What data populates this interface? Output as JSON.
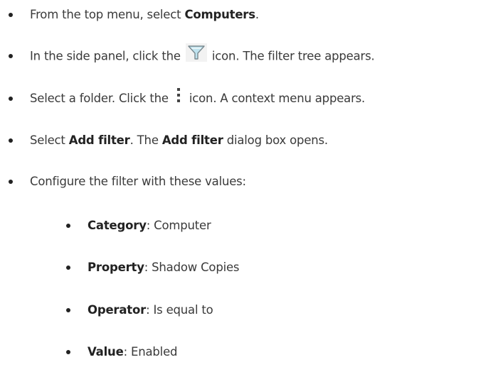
{
  "steps": [
    {
      "pre": "From the top menu, select ",
      "bold": "Computers",
      "post": "."
    },
    {
      "pre": "In the side panel, click the ",
      "icon": "filter-icon",
      "post": " icon. The filter tree appears."
    },
    {
      "pre": "Select a folder. Click the ",
      "icon": "vertical-ellipsis-icon",
      "post": " icon. A context menu appears."
    },
    {
      "pre": "Select ",
      "bold1": "Add filter",
      "mid": ". The ",
      "bold2": "Add filter",
      "post": " dialog box opens."
    },
    {
      "text": "Configure the filter with these values:"
    }
  ],
  "values": [
    {
      "label": "Category",
      "value": ": Computer"
    },
    {
      "label": "Property",
      "value": ": Shadow Copies"
    },
    {
      "label": "Operator",
      "value": ": Is equal to"
    },
    {
      "label": "Value",
      "value": ": Enabled"
    }
  ],
  "colors": {
    "text": "#3a3a3a",
    "bold": "#222222",
    "icon_fill": "#9fd6e8",
    "icon_stroke": "#888888"
  }
}
